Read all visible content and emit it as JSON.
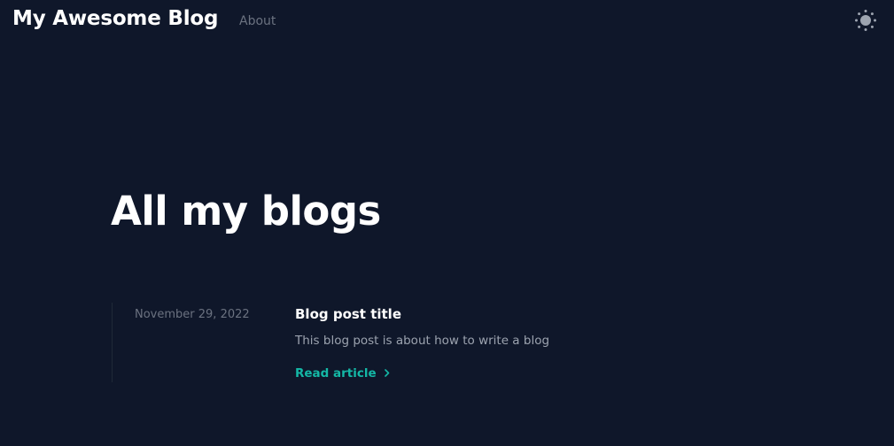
{
  "header": {
    "brand": "My Awesome Blog",
    "nav": [
      {
        "label": "About"
      }
    ],
    "theme_icon": "sun-icon"
  },
  "main": {
    "title": "All my blogs",
    "posts": [
      {
        "date": "November 29, 2022",
        "title": "Blog post title",
        "summary": "This blog post is about how to write a blog",
        "cta": "Read article"
      }
    ]
  },
  "colors": {
    "background": "#0f172a",
    "accent": "#14b8a6",
    "muted": "#6b7280"
  }
}
